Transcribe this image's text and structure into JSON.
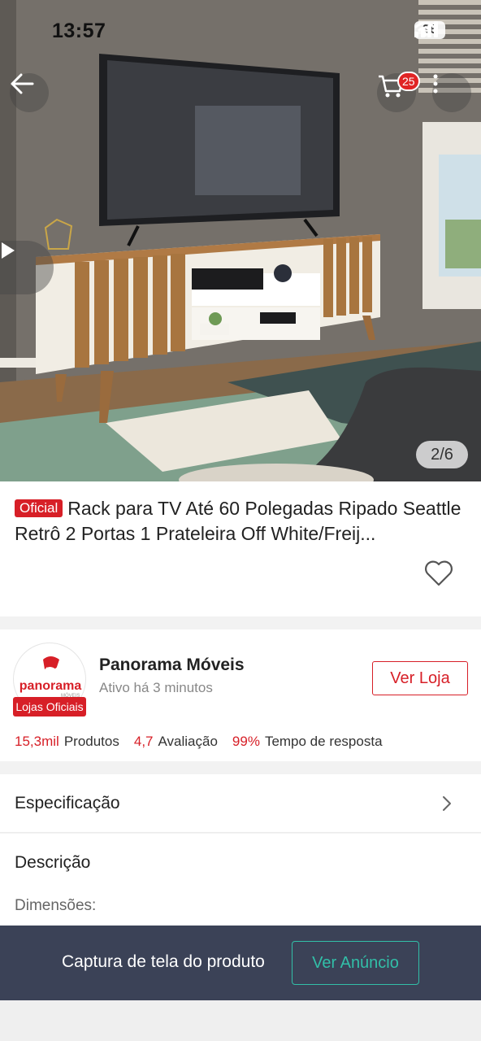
{
  "status_bar": {
    "time": "13:57",
    "battery": "36"
  },
  "top_nav": {
    "cart_count": "25"
  },
  "gallery": {
    "counter": "2/6"
  },
  "product": {
    "official_badge": "Oficial",
    "title": "Rack para TV Até 60 Polegadas Ripado Seattle Retrô 2 Portas 1 Prateleira Off White/Freij..."
  },
  "store": {
    "logo_text": "panorama",
    "logo_subtext": "MÓVEIS",
    "official_tag": "Lojas Oficiais",
    "name": "Panorama Móveis",
    "active": "Ativo há 3 minutos",
    "visit_button": "Ver Loja",
    "stats": [
      {
        "value": "15,3mil",
        "label": "Produtos"
      },
      {
        "value": "4,7",
        "label": "Avaliação"
      },
      {
        "value": "99%",
        "label": "Tempo de resposta"
      }
    ]
  },
  "sections": {
    "specification": "Especificação",
    "description_title": "Descrição",
    "description_text": "Dimensões:"
  },
  "bottom_bar": {
    "text": "Captura de tela do produto",
    "button": "Ver Anúncio"
  },
  "colors": {
    "accent": "#d71f27",
    "teal": "#32bfa8",
    "banner": "#3b4257"
  }
}
